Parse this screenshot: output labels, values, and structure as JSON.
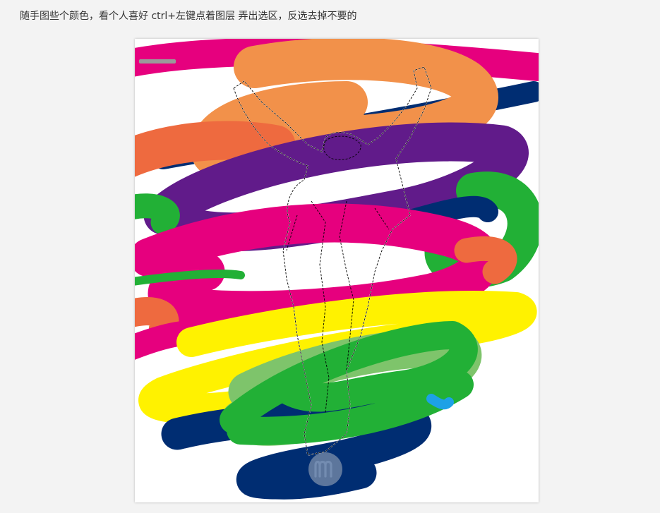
{
  "instruction": {
    "text": "随手图些个颜色，看个人喜好 ctrl+左键点着图层 弄出选区，反选去掉不要的"
  },
  "figure": {
    "description_icon": "watermark-logo-icon",
    "colors": {
      "orange": "#f2914a",
      "dark_orange": "#ee6a3f",
      "magenta": "#e6007e",
      "purple": "#611b8a",
      "navy": "#002d72",
      "green": "#22b036",
      "light_green": "#7ec46b",
      "yellow": "#fff200",
      "cyan": "#1da1e6",
      "background": "#ffffff"
    }
  }
}
